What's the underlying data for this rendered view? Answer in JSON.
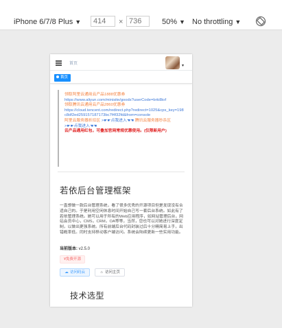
{
  "devtools": {
    "device": "iPhone 6/7/8 Plus",
    "width": "414",
    "times": "×",
    "height": "736",
    "zoom": "50%",
    "throttling": "No throttling",
    "caret": "▼"
  },
  "app": {
    "breadcrumb": "首页",
    "avatar_caret": "▾",
    "tags": [
      {
        "label": "首页",
        "active": true
      }
    ]
  },
  "notice": {
    "aliyun_label": "领取阿里云通用云产品1888优惠券",
    "aliyun_url": "https://www.aliyun.com/minisite/goods?userCode=brki8iof",
    "tencent_label": "领取腾讯云通用云产品2860优惠券",
    "tencent_url": "https://cloud.tencent.com/redirect.php?redirect=1025&cps_key=198c8df2ed259157187173bc7f4f32fd&from=console",
    "aliyun_zone": "阿里云服务器折扣区",
    "aliyun_link": ">☛☛点我进入☚☚",
    "tencent_zone": "腾讯云服务器秒杀区",
    "tencent_link": ">☛☛点我进入☚☚",
    "footer": "云产品通用红包，可叠加官网常规优惠使用。(仅限新用户)"
  },
  "main": {
    "title": "若依后台管理框架",
    "description": "一直想做一款后台管理系统，看了很多优秀的开源项目但是发现没有合适自己的。于是利用空闲休息时间开始自己写一套后台系统。如此有了若依管理系统。她可以用于所有的Web应用程序，如网站管理后台，网站会员中心，CMS，CRM，OA等等，当然，您也可以对她进行深度定制，以做出更强系统。所有前端后台代码封装过后十分精简易上手，出错概率低。同时支持移动客户端访问。系统会陆续更新一些实用功能。",
    "version_label": "当前版本:",
    "version_value": "v2.5.0",
    "free_badge": "¥免费开源",
    "btn_code": "访问码云",
    "btn_home": "访问主页",
    "tech_title": "技术选型"
  },
  "colors": {
    "accent": "#1890ff",
    "notice_orange": "#f48240",
    "notice_blue": "#3d78d8",
    "notice_red": "#e02020"
  }
}
